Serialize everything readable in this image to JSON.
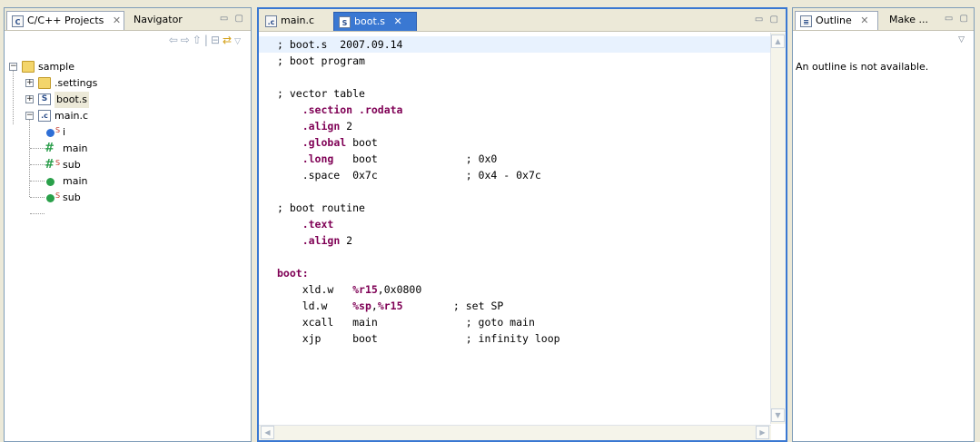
{
  "projects_view": {
    "tabs": [
      {
        "label": "C/C++ Projects"
      },
      {
        "label": "Navigator"
      }
    ],
    "tree": {
      "root": "sample",
      "settings": ".settings",
      "boot_file": "boot.s",
      "main_file": "main.c",
      "members": [
        "i",
        "main",
        "sub",
        "main",
        "sub"
      ]
    }
  },
  "editor": {
    "tabs": [
      {
        "label": "main.c"
      },
      {
        "label": "boot.s"
      }
    ],
    "lines": [
      [
        {
          "t": "; boot.s  2007.09.14",
          "c": ""
        }
      ],
      [
        {
          "t": "; boot program",
          "c": ""
        }
      ],
      [
        {
          "t": "",
          "c": ""
        }
      ],
      [
        {
          "t": "; vector table",
          "c": ""
        }
      ],
      [
        {
          "t": "    ",
          "c": ""
        },
        {
          "t": ".section .rodata",
          "c": "kw"
        }
      ],
      [
        {
          "t": "    ",
          "c": ""
        },
        {
          "t": ".align",
          "c": "kw"
        },
        {
          "t": " 2",
          "c": ""
        }
      ],
      [
        {
          "t": "    ",
          "c": ""
        },
        {
          "t": ".global",
          "c": "kw"
        },
        {
          "t": " boot",
          "c": ""
        }
      ],
      [
        {
          "t": "    ",
          "c": ""
        },
        {
          "t": ".long",
          "c": "kw"
        },
        {
          "t": "   boot              ; 0x0",
          "c": ""
        }
      ],
      [
        {
          "t": "    .space  0x7c              ; 0x4 - 0x7c",
          "c": ""
        }
      ],
      [
        {
          "t": "",
          "c": ""
        }
      ],
      [
        {
          "t": "; boot routine",
          "c": ""
        }
      ],
      [
        {
          "t": "    ",
          "c": ""
        },
        {
          "t": ".text",
          "c": "kw"
        }
      ],
      [
        {
          "t": "    ",
          "c": ""
        },
        {
          "t": ".align",
          "c": "kw"
        },
        {
          "t": " 2",
          "c": ""
        }
      ],
      [
        {
          "t": "",
          "c": ""
        }
      ],
      [
        {
          "t": "boot:",
          "c": "kw"
        }
      ],
      [
        {
          "t": "    xld.w   ",
          "c": ""
        },
        {
          "t": "%r15",
          "c": "reg"
        },
        {
          "t": ",0x0800",
          "c": ""
        }
      ],
      [
        {
          "t": "    ld.w    ",
          "c": ""
        },
        {
          "t": "%sp",
          "c": "reg"
        },
        {
          "t": ",",
          "c": ""
        },
        {
          "t": "%r15",
          "c": "reg"
        },
        {
          "t": "        ; set SP",
          "c": ""
        }
      ],
      [
        {
          "t": "    xcall   main              ; goto main",
          "c": ""
        }
      ],
      [
        {
          "t": "    xjp     boot              ; infinity loop",
          "c": ""
        }
      ]
    ]
  },
  "outline_view": {
    "tabs": [
      {
        "label": "Outline"
      },
      {
        "label": "Make ..."
      }
    ],
    "message": "An outline is not available."
  }
}
